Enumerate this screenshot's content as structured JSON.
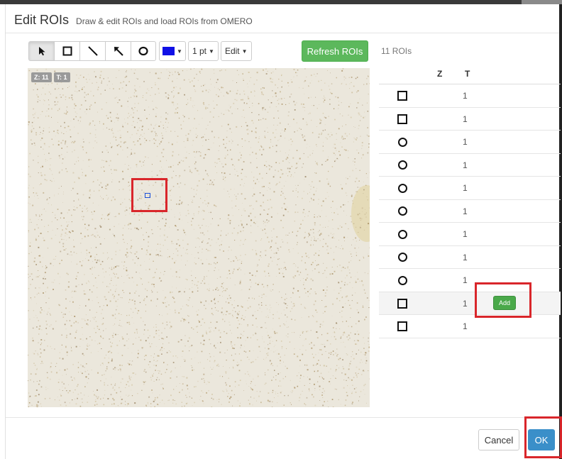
{
  "dialog": {
    "title": "Edit ROIs",
    "subtitle": "Draw & edit ROIs and load ROIs from OMERO"
  },
  "toolbar": {
    "tools": [
      {
        "name": "select-tool",
        "icon": "arrow-pointer-icon"
      },
      {
        "name": "rectangle-tool",
        "icon": "square-icon"
      },
      {
        "name": "line-tool",
        "icon": "line-icon"
      },
      {
        "name": "arrow-tool",
        "icon": "arrow-icon"
      },
      {
        "name": "ellipse-tool",
        "icon": "circle-icon"
      }
    ],
    "color": "#1010e6",
    "stroke_width_label": "1 pt",
    "edit_label": "Edit",
    "refresh_label": "Refresh ROIs",
    "refresh_color": "#5cb85c"
  },
  "viewer": {
    "z_badge": "Z: 11",
    "t_badge": "T: 1"
  },
  "roi_panel": {
    "count_label": "11 ROIs",
    "columns": {
      "z": "Z",
      "t": "T"
    },
    "rows": [
      {
        "shape": "rectangle",
        "t": "1"
      },
      {
        "shape": "rectangle",
        "t": "1"
      },
      {
        "shape": "ellipse",
        "t": "1"
      },
      {
        "shape": "ellipse",
        "t": "1"
      },
      {
        "shape": "ellipse",
        "t": "1"
      },
      {
        "shape": "ellipse",
        "t": "1"
      },
      {
        "shape": "ellipse",
        "t": "1"
      },
      {
        "shape": "ellipse",
        "t": "1"
      },
      {
        "shape": "ellipse",
        "t": "1"
      },
      {
        "shape": "rectangle",
        "t": "1",
        "selected": true,
        "add_label": "Add"
      },
      {
        "shape": "rectangle",
        "t": "1"
      }
    ],
    "add_color": "#4aa94a"
  },
  "footer": {
    "cancel_label": "Cancel",
    "ok_label": "OK",
    "ok_color": "#3a8fc9"
  },
  "highlight_color": "#d9262b"
}
